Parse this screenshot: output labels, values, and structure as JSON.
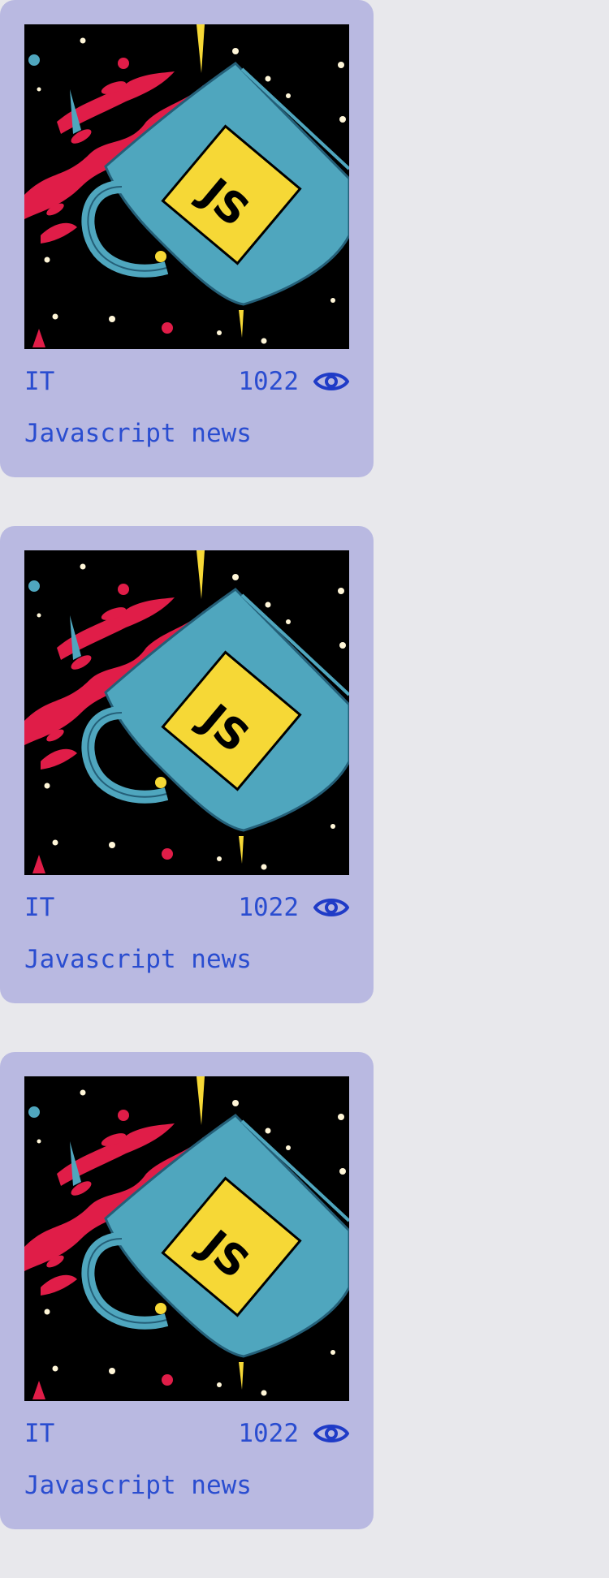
{
  "colors": {
    "page_background": "#e8e8ec",
    "card_background": "#b9b9e1",
    "text": "#2a4dd0",
    "icon": "#1f3bc7"
  },
  "cards": [
    {
      "image": "javascript-coffee-mug-illustration",
      "category": "IT",
      "views": "1022",
      "views_icon": "eye-icon",
      "title": "Javascript news"
    },
    {
      "image": "javascript-coffee-mug-illustration",
      "category": "IT",
      "views": "1022",
      "views_icon": "eye-icon",
      "title": "Javascript news"
    },
    {
      "image": "javascript-coffee-mug-illustration",
      "category": "IT",
      "views": "1022",
      "views_icon": "eye-icon",
      "title": "Javascript news"
    }
  ],
  "illustration": {
    "badge_text": "JS"
  }
}
